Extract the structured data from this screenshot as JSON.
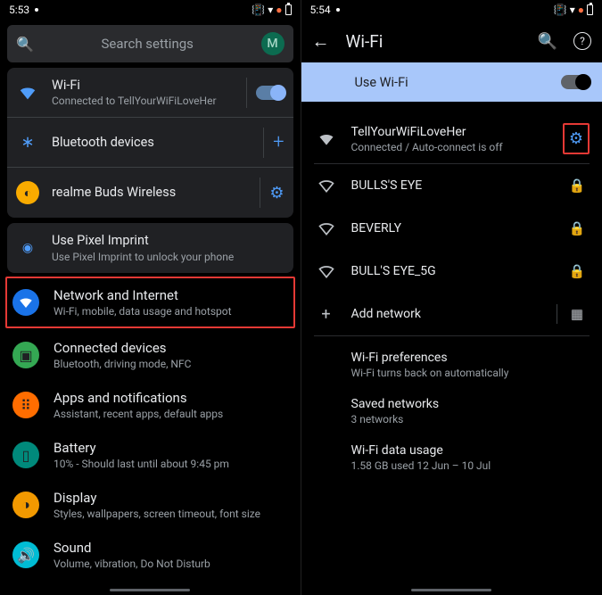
{
  "left": {
    "status_time": "5:53",
    "search_placeholder": "Search settings",
    "avatar_letter": "M",
    "cards": {
      "wifi": {
        "title": "Wi-Fi",
        "sub": "Connected to TellYourWiFiLoveHer"
      },
      "bt": {
        "title": "Bluetooth devices"
      },
      "buds": {
        "title": "realme Buds Wireless"
      },
      "imprint": {
        "title": "Use Pixel Imprint",
        "sub": "Use Pixel Imprint to unlock your phone"
      }
    },
    "items": {
      "network": {
        "title": "Network and Internet",
        "sub": "Wi-Fi, mobile, data usage and hotspot"
      },
      "connected": {
        "title": "Connected devices",
        "sub": "Bluetooth, driving mode, NFC"
      },
      "apps": {
        "title": "Apps and notifications",
        "sub": "Assistant, recent apps, default apps"
      },
      "battery": {
        "title": "Battery",
        "sub": "10% - Should last until about 9:45 pm"
      },
      "display": {
        "title": "Display",
        "sub": "Styles, wallpapers, screen timeout, font size"
      },
      "sound": {
        "title": "Sound",
        "sub": "Volume, vibration, Do Not Disturb"
      }
    }
  },
  "right": {
    "status_time": "5:54",
    "title": "Wi-Fi",
    "use_wifi_label": "Use Wi-Fi",
    "networks": [
      {
        "name": "TellYourWiFiLoveHer",
        "sub": "Connected / Auto-connect is off",
        "action": "gear"
      },
      {
        "name": "BULLS'S EYE",
        "action": "lock"
      },
      {
        "name": "BEVERLY",
        "action": "lock"
      },
      {
        "name": "BULL'S EYE_5G",
        "action": "lock"
      }
    ],
    "add_network_label": "Add network",
    "prefs": {
      "wifi_pref": {
        "title": "Wi-Fi preferences",
        "sub": "Wi-Fi turns back on automatically"
      },
      "saved": {
        "title": "Saved networks",
        "sub": "3 networks"
      },
      "data_usage": {
        "title": "Wi-Fi data usage",
        "sub": "1.58 GB used 12 Jun – 10 Jul"
      }
    }
  }
}
